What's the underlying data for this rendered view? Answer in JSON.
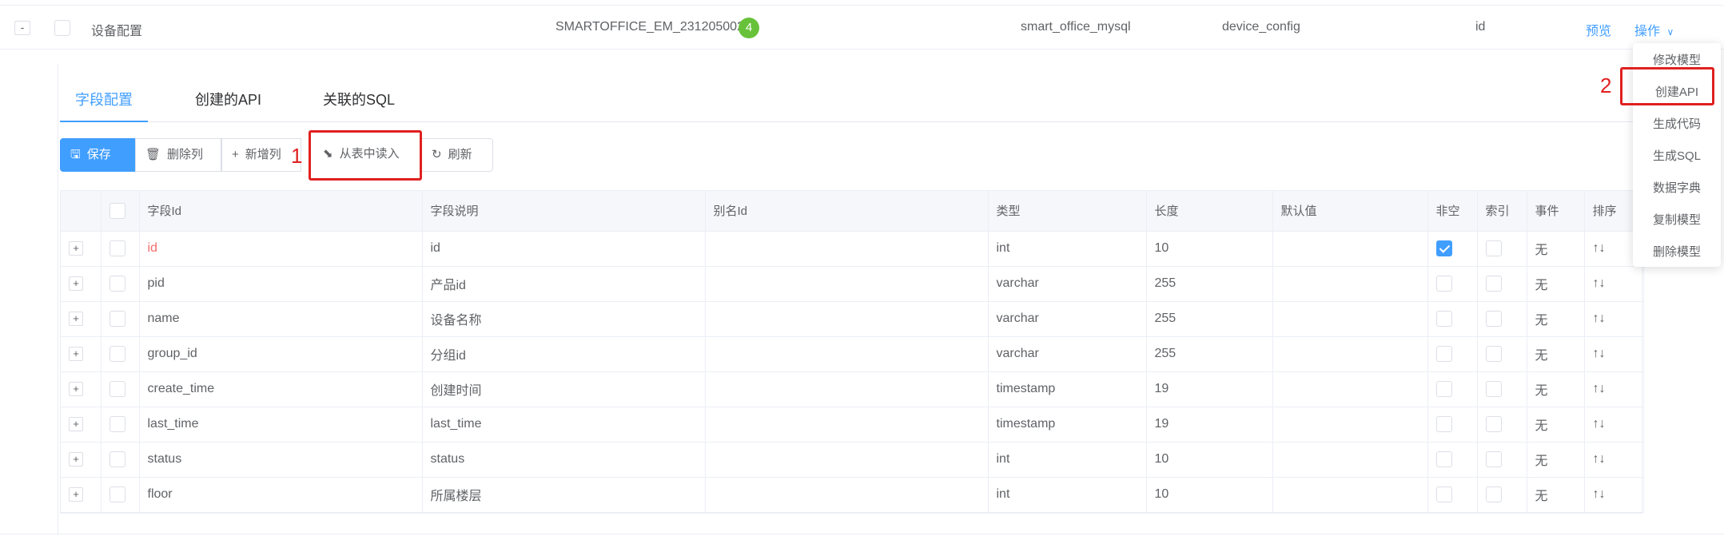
{
  "top_row": {
    "collapse": "-",
    "name": "设备配置",
    "code": "SMARTOFFICE_EM_231205002",
    "badge": "4",
    "database": "smart_office_mysql",
    "table": "device_config",
    "pk": "id",
    "preview_link": "预览",
    "actions_link": "操作"
  },
  "tabs": [
    {
      "label": "字段配置",
      "active": true
    },
    {
      "label": "创建的API",
      "active": false
    },
    {
      "label": "关联的SQL",
      "active": false
    }
  ],
  "toolbar": {
    "save": "保存",
    "delete_column": "删除列",
    "add_column": "新增列",
    "read_from_table": "从表中读入",
    "refresh": "刷新"
  },
  "annotations": {
    "step1": "1",
    "step2": "2"
  },
  "columns": [
    "字段Id",
    "字段说明",
    "别名Id",
    "类型",
    "长度",
    "默认值",
    "非空",
    "索引",
    "事件",
    "排序"
  ],
  "rows": [
    {
      "field_id": "id",
      "desc": "id",
      "alias": "",
      "type": "int",
      "length": "10",
      "default": "",
      "not_null": true,
      "event": "无",
      "sort": "↑↓"
    },
    {
      "field_id": "pid",
      "desc": "产品id",
      "alias": "",
      "type": "varchar",
      "length": "255",
      "default": "",
      "not_null": false,
      "event": "无",
      "sort": "↑↓"
    },
    {
      "field_id": "name",
      "desc": "设备名称",
      "alias": "",
      "type": "varchar",
      "length": "255",
      "default": "",
      "not_null": false,
      "event": "无",
      "sort": "↑↓"
    },
    {
      "field_id": "group_id",
      "desc": "分组id",
      "alias": "",
      "type": "varchar",
      "length": "255",
      "default": "",
      "not_null": false,
      "event": "无",
      "sort": "↑↓"
    },
    {
      "field_id": "create_time",
      "desc": "创建时间",
      "alias": "",
      "type": "timestamp",
      "length": "19",
      "default": "",
      "not_null": false,
      "event": "无",
      "sort": "↑↓"
    },
    {
      "field_id": "last_time",
      "desc": "last_time",
      "alias": "",
      "type": "timestamp",
      "length": "19",
      "default": "",
      "not_null": false,
      "event": "无",
      "sort": "↑↓"
    },
    {
      "field_id": "status",
      "desc": "status",
      "alias": "",
      "type": "int",
      "length": "10",
      "default": "",
      "not_null": false,
      "event": "无",
      "sort": "↑↓"
    },
    {
      "field_id": "floor",
      "desc": "所属楼层",
      "alias": "",
      "type": "int",
      "length": "10",
      "default": "",
      "not_null": false,
      "event": "无",
      "sort": "↑↓"
    }
  ],
  "dropdown": [
    "修改模型",
    "创建API",
    "生成代码",
    "生成SQL",
    "数据字典",
    "复制模型",
    "删除模型"
  ],
  "colors": {
    "accent": "#409eff",
    "highlight": "#e02020",
    "badge": "#67c23a"
  }
}
